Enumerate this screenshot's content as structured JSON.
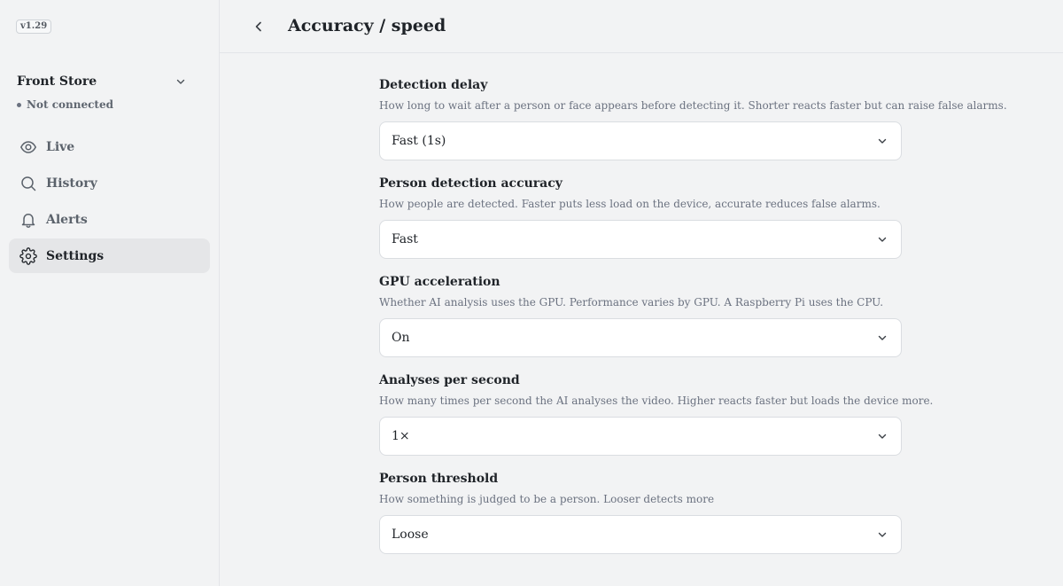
{
  "app": {
    "version": "v1.29",
    "store_name": "Front Store",
    "connection_status": "Not connected"
  },
  "sidebar": {
    "items": [
      {
        "label": "Live",
        "icon": "eye-icon",
        "active": false
      },
      {
        "label": "History",
        "icon": "search-icon",
        "active": false
      },
      {
        "label": "Alerts",
        "icon": "bell-icon",
        "active": false
      },
      {
        "label": "Settings",
        "icon": "gear-icon",
        "active": true
      }
    ]
  },
  "header": {
    "title": "Accuracy / speed"
  },
  "settings": [
    {
      "title": "Detection delay",
      "description": "How long to wait after a person or face appears before detecting it. Shorter reacts faster but can raise false alarms.",
      "value": "Fast (1s)"
    },
    {
      "title": "Person detection accuracy",
      "description": "How people are detected. Faster puts less load on the device, accurate reduces false alarms.",
      "value": "Fast"
    },
    {
      "title": "GPU acceleration",
      "description": "Whether AI analysis uses the GPU. Performance varies by GPU. A Raspberry Pi uses the CPU.",
      "value": "On"
    },
    {
      "title": "Analyses per second",
      "description": "How many times per second the AI analyses the video. Higher reacts faster but loads the device more.",
      "value": "1×"
    },
    {
      "title": "Person threshold",
      "description": "How something is judged to be a person. Looser detects more",
      "value": "Loose"
    }
  ],
  "colors": {
    "background": "#f2f3f4",
    "active_nav": "#e5e6e8",
    "text_primary": "#1f2328",
    "text_muted": "#6b7280"
  }
}
